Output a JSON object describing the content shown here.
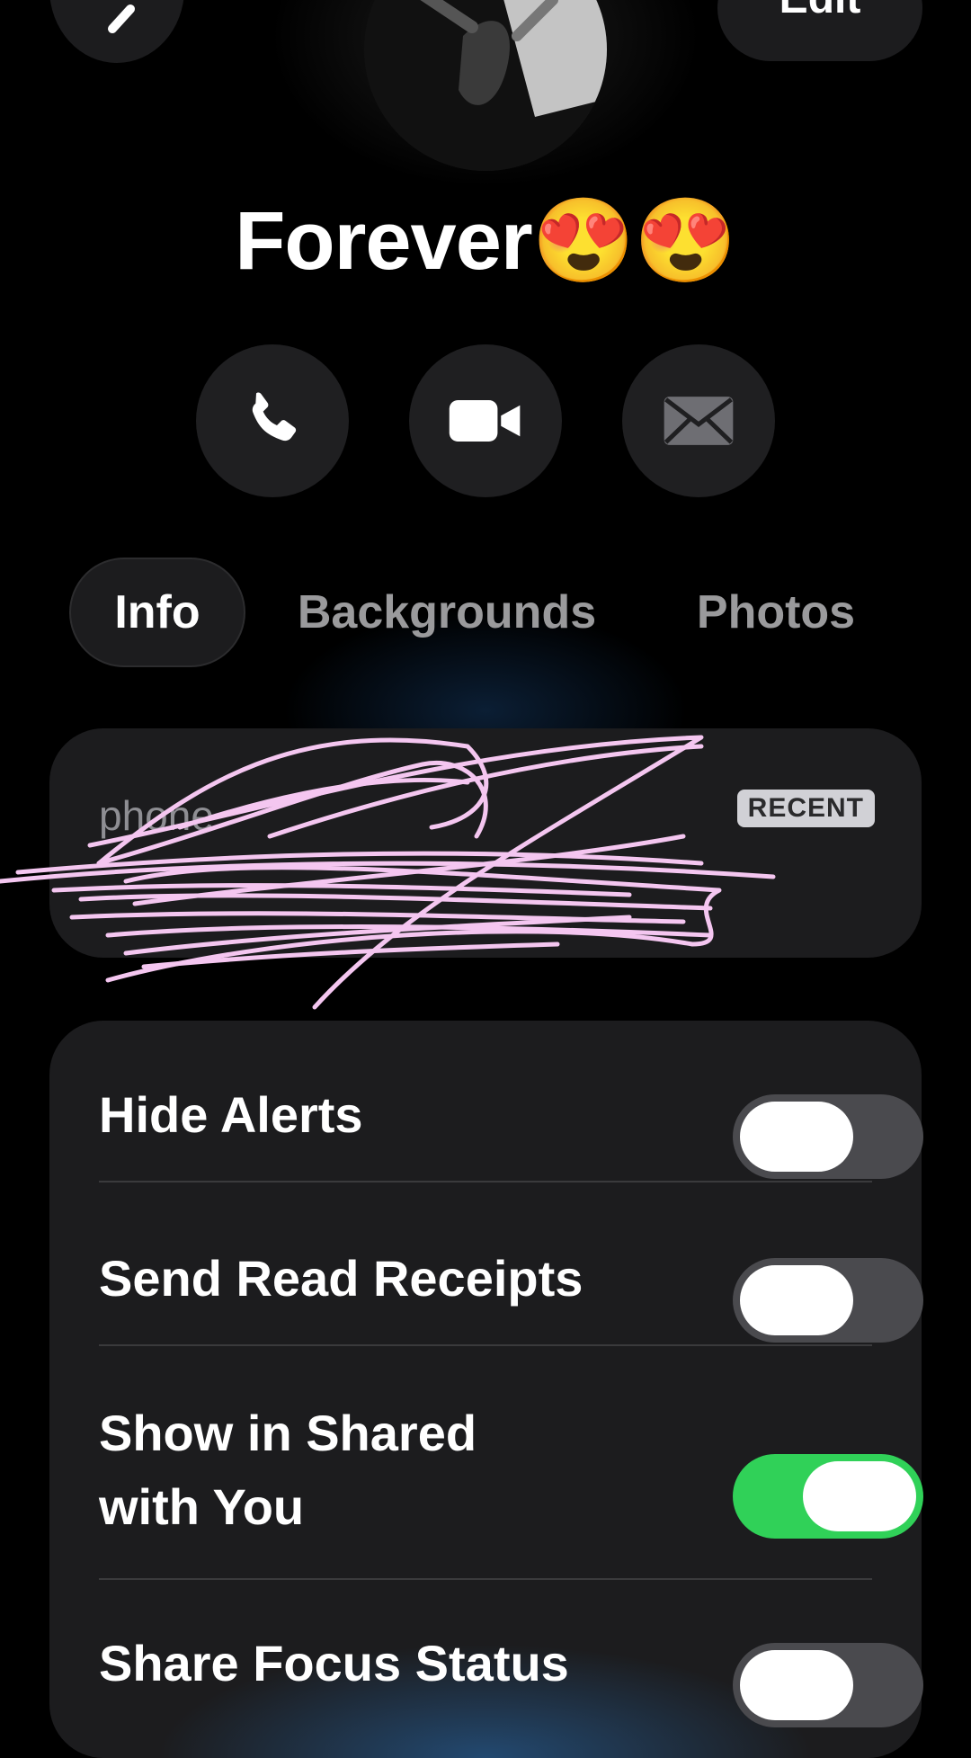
{
  "header": {
    "back_icon": "chevron-left-icon",
    "edit_label": "Edit"
  },
  "contact": {
    "name": "Forever😍😍"
  },
  "actions": {
    "call_icon": "phone-icon",
    "video_icon": "video-camera-icon",
    "mail_icon": "envelope-icon"
  },
  "tabs": [
    {
      "label": "Info",
      "active": true
    },
    {
      "label": "Backgrounds",
      "active": false
    },
    {
      "label": "Photos",
      "active": false
    }
  ],
  "phone": {
    "label": "phone",
    "badge": "RECENT",
    "value": "",
    "redacted": true
  },
  "settings": [
    {
      "label": "Hide Alerts",
      "on": false
    },
    {
      "label": "Send Read Receipts",
      "on": false
    },
    {
      "label": "Show in Shared\nwith You",
      "on": true
    },
    {
      "label": "Share Focus Status",
      "on": false
    }
  ],
  "colors": {
    "toggle_on": "#30d158",
    "toggle_off": "#4a4a4e",
    "card": "#1c1c1e",
    "scribble": "#f4c6f0"
  }
}
